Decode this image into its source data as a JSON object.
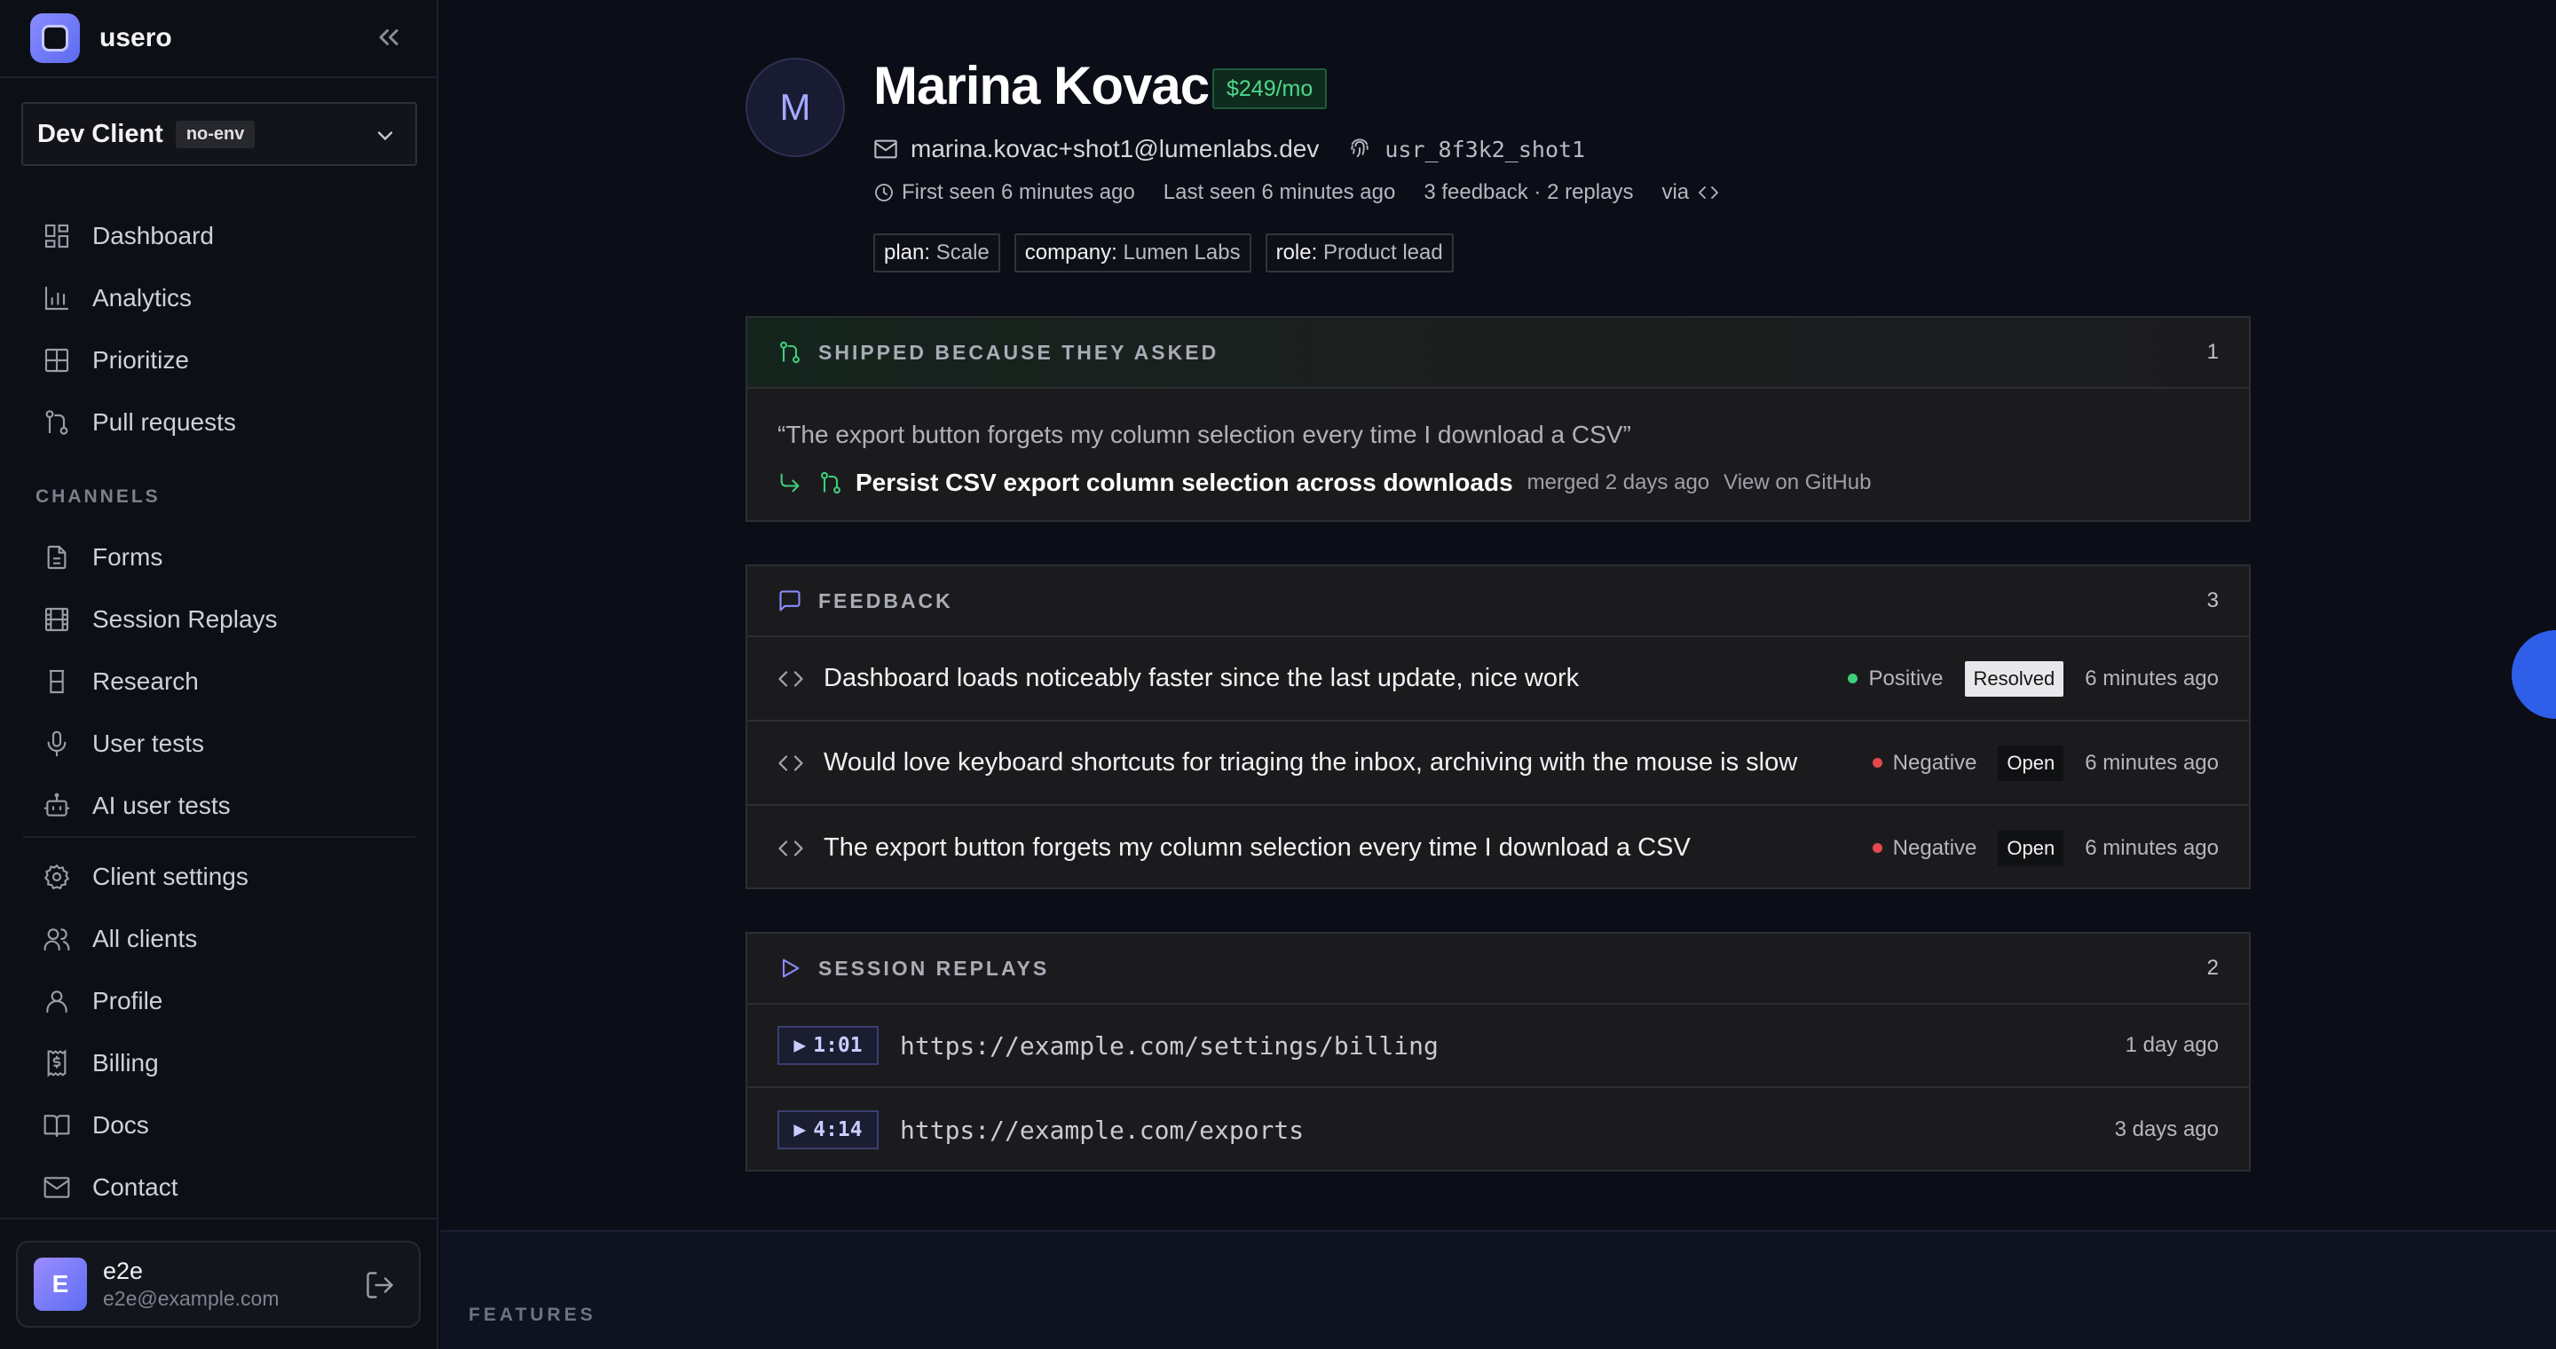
{
  "sidebar": {
    "brand": "usero",
    "client": {
      "name": "Dev Client",
      "env": "no-env"
    },
    "nav_main": [
      {
        "label": "Dashboard",
        "icon": "dashboard-icon"
      },
      {
        "label": "Analytics",
        "icon": "bar-chart-icon"
      },
      {
        "label": "Prioritize",
        "icon": "grid-icon"
      },
      {
        "label": "Pull requests",
        "icon": "git-pull-request-icon"
      }
    ],
    "channels_label": "CHANNELS",
    "nav_channels": [
      {
        "label": "Forms",
        "icon": "file-text-icon"
      },
      {
        "label": "Session Replays",
        "icon": "film-icon"
      },
      {
        "label": "Research",
        "icon": "flask-icon"
      },
      {
        "label": "User tests",
        "icon": "microphone-icon"
      },
      {
        "label": "AI user tests",
        "icon": "bot-icon"
      }
    ],
    "nav_settings": [
      {
        "label": "Client settings",
        "icon": "gear-icon"
      },
      {
        "label": "All clients",
        "icon": "users-icon"
      },
      {
        "label": "Profile",
        "icon": "user-icon"
      },
      {
        "label": "Billing",
        "icon": "receipt-icon"
      },
      {
        "label": "Docs",
        "icon": "book-icon"
      },
      {
        "label": "Contact",
        "icon": "mail-icon"
      }
    ],
    "user": {
      "initial": "E",
      "name": "e2e",
      "email": "e2e@example.com"
    }
  },
  "profile": {
    "initial": "M",
    "name": "Marina Kovac",
    "price": "$249/mo",
    "email": "marina.kovac+shot1@lumenlabs.dev",
    "user_id": "usr_8f3k2_shot1",
    "first_seen": "First seen 6 minutes ago",
    "last_seen": "Last seen 6 minutes ago",
    "counts": "3 feedback · 2 replays",
    "via": "via",
    "tags": [
      {
        "key": "plan:",
        "value": "Scale"
      },
      {
        "key": "company:",
        "value": "Lumen Labs"
      },
      {
        "key": "role:",
        "value": "Product lead"
      }
    ]
  },
  "shipped": {
    "title": "SHIPPED BECAUSE THEY ASKED",
    "count": "1",
    "quote": "“The export button forgets my column selection every time I download a CSV”",
    "pr_title": "Persist CSV export column selection across downloads",
    "pr_meta": "merged 2 days ago",
    "pr_link": "View on GitHub"
  },
  "feedback": {
    "title": "FEEDBACK",
    "count": "3",
    "items": [
      {
        "text": "Dashboard loads noticeably faster since the last update, nice work",
        "sentiment": "Positive",
        "sentiment_color": "#3ecf7a",
        "status": "Resolved",
        "time": "6 minutes ago"
      },
      {
        "text": "Would love keyboard shortcuts for triaging the inbox, archiving with the mouse is slow",
        "sentiment": "Negative",
        "sentiment_color": "#e5484d",
        "status": "Open",
        "time": "6 minutes ago"
      },
      {
        "text": "The export button forgets my column selection every time I download a CSV",
        "sentiment": "Negative",
        "sentiment_color": "#e5484d",
        "status": "Open",
        "time": "6 minutes ago"
      }
    ]
  },
  "replays": {
    "title": "SESSION REPLAYS",
    "count": "2",
    "items": [
      {
        "duration": "1:01",
        "url": "https://example.com/settings/billing",
        "time": "1 day ago"
      },
      {
        "duration": "4:14",
        "url": "https://example.com/exports",
        "time": "3 days ago"
      }
    ]
  },
  "footer": {
    "features_label": "FEATURES"
  },
  "colors": {
    "accent": "#8b8cff",
    "positive": "#3ecf7a",
    "negative": "#e5484d",
    "price_green": "#4cd98a"
  }
}
